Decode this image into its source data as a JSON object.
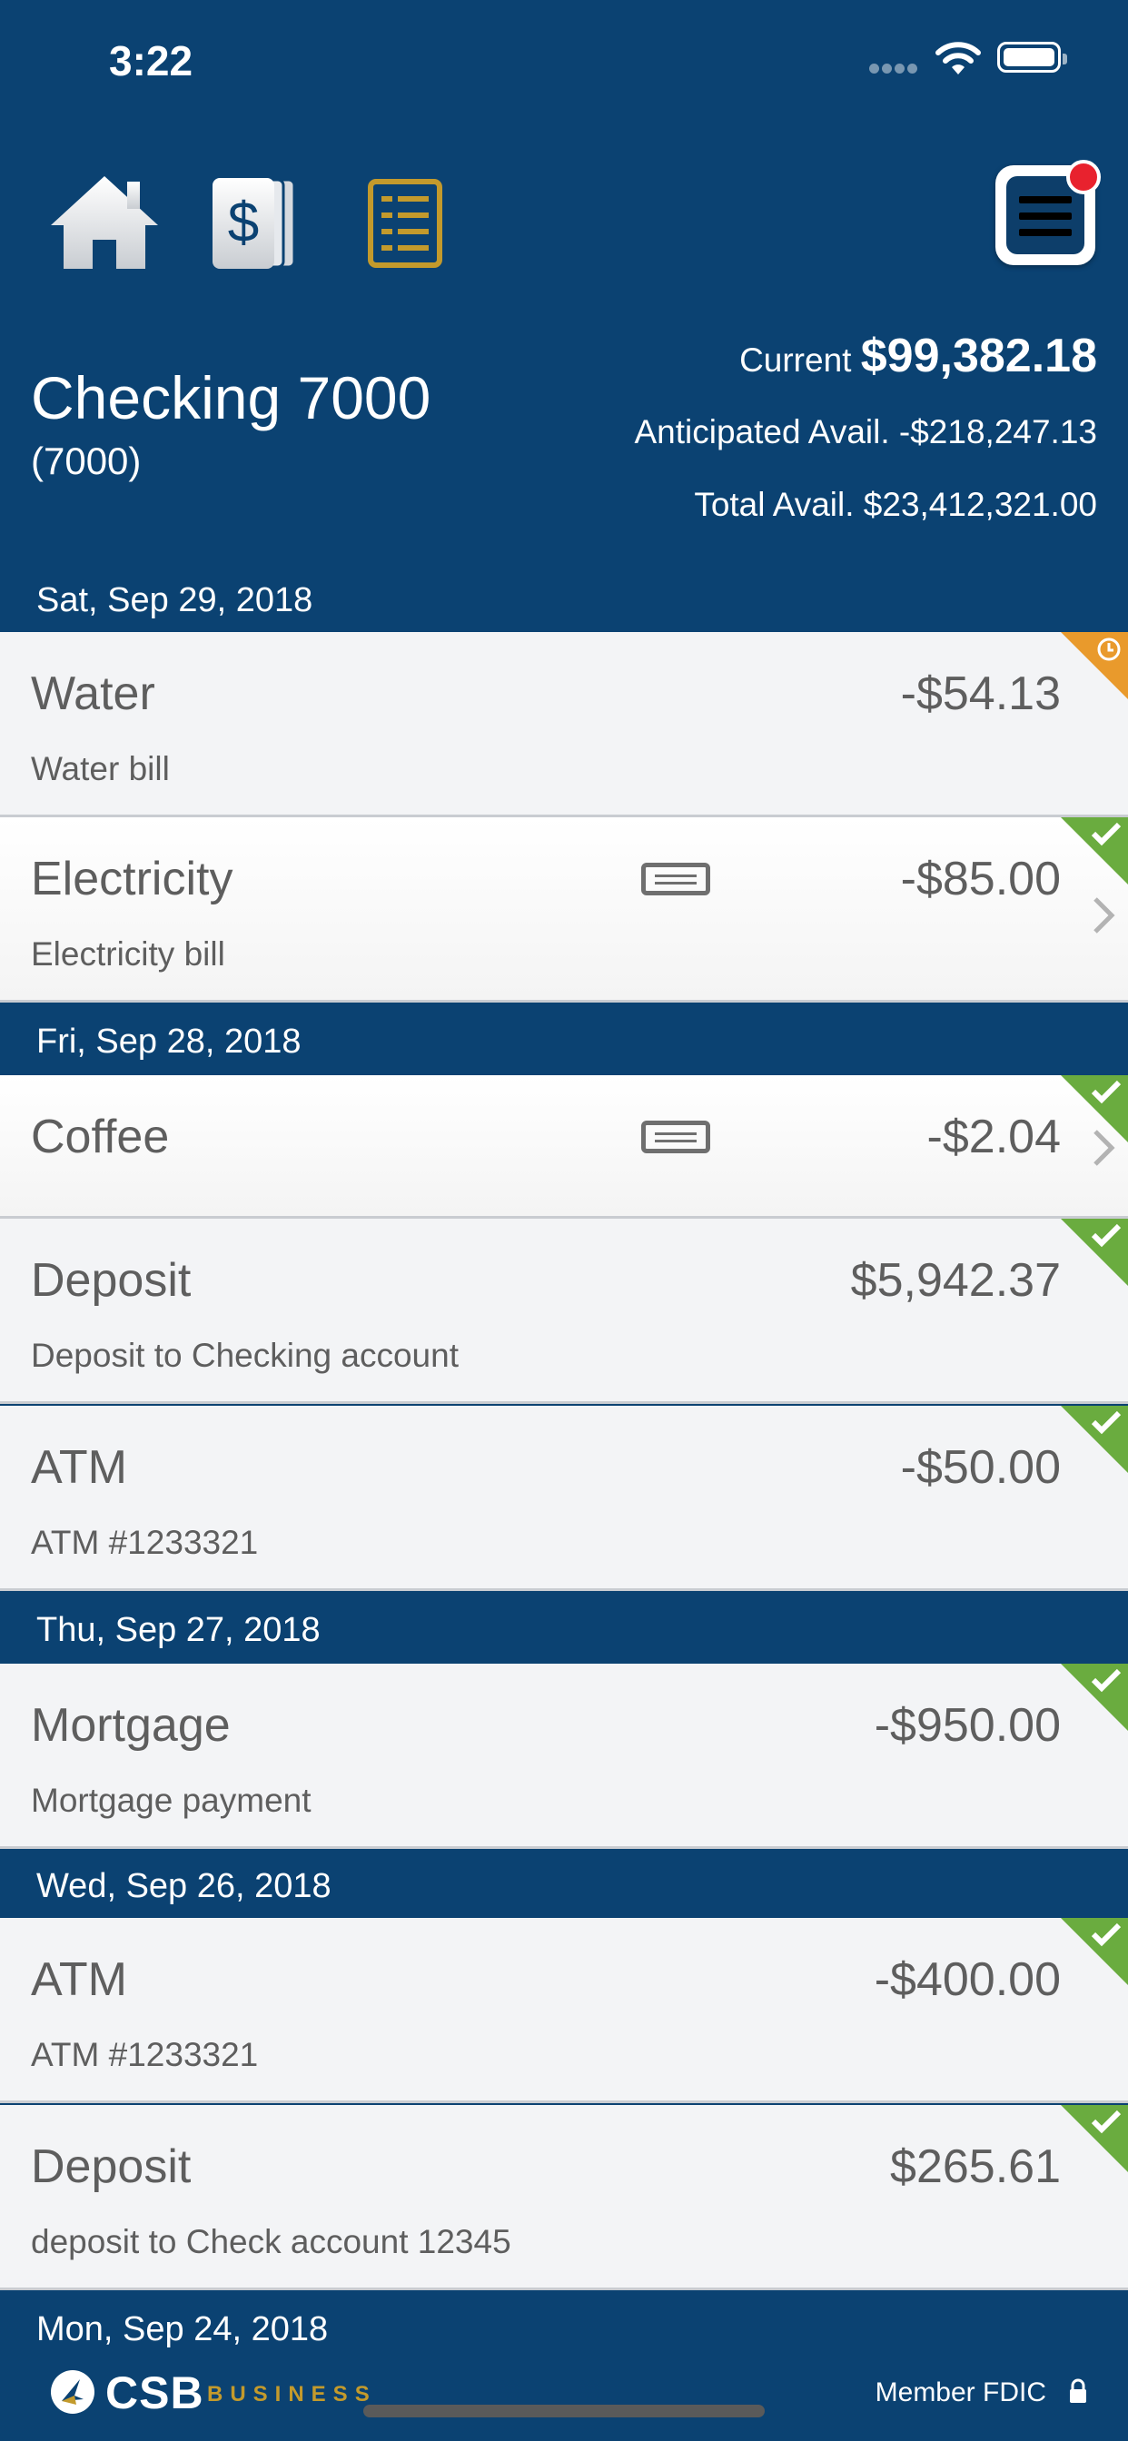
{
  "status_bar": {
    "time": "3:22"
  },
  "toolbar": {
    "icons": [
      "home-icon",
      "dollar-icon",
      "document-list-icon",
      "menu-icon"
    ],
    "accent": "#c39a2c",
    "notification_color": "#e8222e"
  },
  "account": {
    "name": "Checking 7000",
    "number": "(7000)",
    "current_label": "Current",
    "current_value": "$99,382.18",
    "anticipated_label": "Anticipated Avail.",
    "anticipated_value": "-$218,247.13",
    "total_label": "Total Avail.",
    "total_value": "$23,412,321.00"
  },
  "groups": [
    {
      "date": "Sat, Sep 29, 2018",
      "items": [
        {
          "title": "Water",
          "desc": "Water bill",
          "amount": "-$54.13",
          "status": "pending",
          "receipt": false,
          "chevron": false
        },
        {
          "title": "Electricity",
          "desc": "Electricity bill",
          "amount": "-$85.00",
          "status": "cleared",
          "receipt": true,
          "chevron": true
        }
      ]
    },
    {
      "date": "Fri, Sep 28, 2018",
      "items": [
        {
          "title": "Coffee",
          "desc": "",
          "amount": "-$2.04",
          "status": "cleared",
          "receipt": true,
          "chevron": true
        },
        {
          "title": "Deposit",
          "desc": "Deposit to Checking account",
          "amount": "$5,942.37",
          "status": "cleared",
          "receipt": false,
          "chevron": false
        },
        {
          "title": "ATM",
          "desc": "ATM #1233321",
          "amount": "-$50.00",
          "status": "cleared",
          "receipt": false,
          "chevron": false
        }
      ]
    },
    {
      "date": "Thu, Sep 27, 2018",
      "items": [
        {
          "title": "Mortgage",
          "desc": "Mortgage payment",
          "amount": "-$950.00",
          "status": "cleared",
          "receipt": false,
          "chevron": false
        }
      ]
    },
    {
      "date": "Wed, Sep 26, 2018",
      "items": [
        {
          "title": "ATM",
          "desc": "ATM #1233321",
          "amount": "-$400.00",
          "status": "cleared",
          "receipt": false,
          "chevron": false
        },
        {
          "title": "Deposit",
          "desc": "deposit to Check account 12345",
          "amount": "$265.61",
          "status": "cleared",
          "receipt": false,
          "chevron": false
        }
      ]
    },
    {
      "date": "Mon, Sep 24, 2018",
      "items": []
    }
  ],
  "footer": {
    "brand": "CSB",
    "brand_sub": "BUSINESS",
    "fdic": "Member FDIC"
  },
  "colors": {
    "header_bg": "#0b4272",
    "cleared": "#6aac3f",
    "pending": "#e99a2c"
  }
}
